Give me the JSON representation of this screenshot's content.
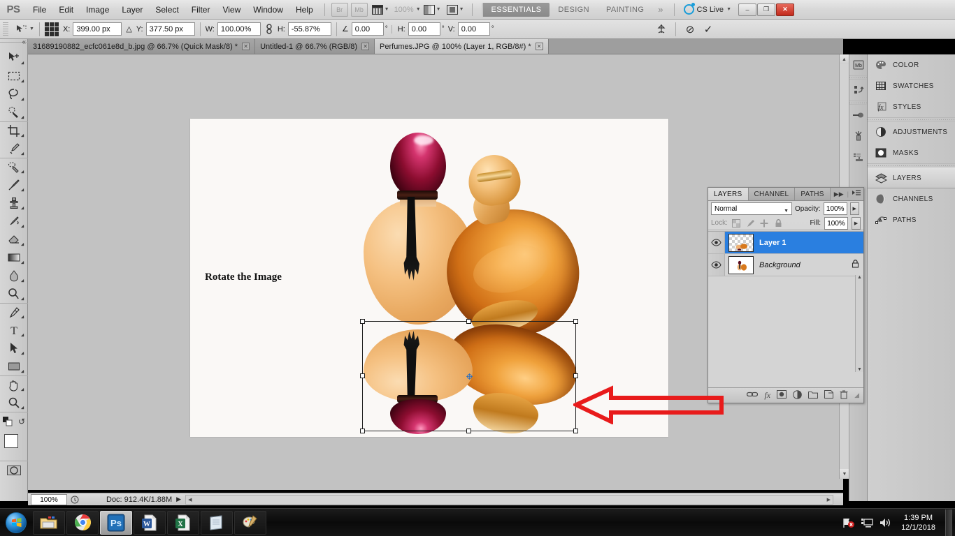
{
  "app": {
    "logo": "PS",
    "menus": [
      "File",
      "Edit",
      "Image",
      "Layer",
      "Select",
      "Filter",
      "View",
      "Window",
      "Help"
    ],
    "bridge_label": "Br",
    "minibridge_label": "Mb",
    "zoom_level": "100%",
    "workspaces": [
      "ESSENTIALS",
      "DESIGN",
      "PAINTING"
    ],
    "workspace_active": "ESSENTIALS",
    "workspace_overflow": "»",
    "cs_live": "CS Live",
    "window_minimize": "–",
    "window_restore": "❐",
    "window_close": "✕"
  },
  "options_bar": {
    "tool_icon": "move-tool-icon",
    "x_label": "X:",
    "x_value": "399.00 px",
    "delta_symbol": "△",
    "y_label": "Y:",
    "y_value": "377.50 px",
    "w_label": "W:",
    "w_value": "100.00%",
    "link_icon": "chain-link-icon",
    "h_label": "H:",
    "h_value": "-55.87%",
    "angle_icon": "∠",
    "angle_value": "0.00",
    "degree": "°",
    "skew_h_label": "H:",
    "skew_h_value": "0.00",
    "skew_v_label": "V:",
    "skew_v_value": "0.00",
    "warp_icon": "warp-mode-icon",
    "cancel_icon": "⊘",
    "commit_icon": "✓"
  },
  "doc_tabs": [
    {
      "label": "31689190882_ecfc061e8d_b.jpg @ 66.7% (Quick Mask/8) *",
      "active": false,
      "close": "✕"
    },
    {
      "label": "Untitled-1 @ 66.7% (RGB/8)",
      "active": false,
      "close": "✕"
    },
    {
      "label": "Perfumes.JPG @ 100% (Layer 1, RGB/8#) *",
      "active": true,
      "close": "✕"
    }
  ],
  "toolbox": {
    "tools": [
      {
        "name": "move-tool",
        "glyph": "✥"
      },
      {
        "name": "rectangular-marquee-tool",
        "glyph": "⬚"
      },
      {
        "name": "lasso-tool",
        "glyph": "◌"
      },
      {
        "name": "quick-selection-tool",
        "glyph": "❁"
      },
      {
        "name": "crop-tool",
        "glyph": "⌗"
      },
      {
        "name": "eyedropper-tool",
        "glyph": "✒"
      },
      {
        "name": "spot-healing-brush-tool",
        "glyph": "❂"
      },
      {
        "name": "brush-tool",
        "glyph": "✎"
      },
      {
        "name": "clone-stamp-tool",
        "glyph": "⚓"
      },
      {
        "name": "history-brush-tool",
        "glyph": "✿"
      },
      {
        "name": "eraser-tool",
        "glyph": "✂"
      },
      {
        "name": "gradient-tool",
        "glyph": "◨"
      },
      {
        "name": "blur-tool",
        "glyph": "●"
      },
      {
        "name": "dodge-tool",
        "glyph": "◖"
      },
      {
        "name": "pen-tool",
        "glyph": "✐"
      },
      {
        "name": "horizontal-type-tool",
        "glyph": "T"
      },
      {
        "name": "path-selection-tool",
        "glyph": "➤"
      },
      {
        "name": "rectangle-shape-tool",
        "glyph": "▭"
      },
      {
        "name": "hand-tool",
        "glyph": "✋"
      },
      {
        "name": "zoom-tool",
        "glyph": "⌕"
      }
    ],
    "swap_colors_icon": "↺",
    "quick_mask_icon": "◯"
  },
  "canvas": {
    "annotation_text": "Rotate the Image",
    "red_arrow": {
      "name": "red-annotation-arrow",
      "color": "#e81b1b",
      "direction": "left"
    },
    "transform_handles": 8
  },
  "status_bar": {
    "zoom": "100%",
    "doc_info": "Doc: 912.4K/1.88M",
    "arrow": "▶"
  },
  "layers_panel": {
    "tabs": [
      "LAYERS",
      "CHANNEL",
      "PATHS"
    ],
    "active_tab": "LAYERS",
    "collapse_icon": "▶▶",
    "menu_icon": "≡",
    "blend_mode": "Normal",
    "opacity_label": "Opacity:",
    "opacity_value": "100%",
    "lock_label": "Lock:",
    "lock_icons": [
      "lock-transparent-pixels-icon",
      "lock-image-pixels-icon",
      "lock-position-icon",
      "lock-all-icon"
    ],
    "fill_label": "Fill:",
    "fill_value": "100%",
    "layers": [
      {
        "name": "Layer 1",
        "selected": true,
        "visible": true,
        "locked": false,
        "italic": false
      },
      {
        "name": "Background",
        "selected": false,
        "visible": true,
        "locked": true,
        "italic": true
      }
    ],
    "footer_icons": [
      {
        "name": "link-layers-icon",
        "glyph": "⚭"
      },
      {
        "name": "layer-style-fx-icon",
        "glyph": "fx"
      },
      {
        "name": "add-layer-mask-icon",
        "glyph": "▣"
      },
      {
        "name": "new-fill-adjustment-layer-icon",
        "glyph": "◑"
      },
      {
        "name": "new-group-icon",
        "glyph": "▱"
      },
      {
        "name": "new-layer-icon",
        "glyph": "▧"
      },
      {
        "name": "delete-layer-icon",
        "glyph": "⌧"
      }
    ]
  },
  "right_dock": {
    "groups": [
      [
        {
          "label": "COLOR",
          "icon": "color-palette-icon",
          "active": false
        },
        {
          "label": "SWATCHES",
          "icon": "swatches-grid-icon",
          "active": false
        },
        {
          "label": "STYLES",
          "icon": "styles-fx-icon",
          "active": false
        }
      ],
      [
        {
          "label": "ADJUSTMENTS",
          "icon": "adjustments-halfcircle-icon",
          "active": false
        },
        {
          "label": "MASKS",
          "icon": "masks-icon",
          "active": false
        }
      ],
      [
        {
          "label": "LAYERS",
          "icon": "layers-stack-icon",
          "active": true
        },
        {
          "label": "CHANNELS",
          "icon": "channels-sphere-icon",
          "active": false
        },
        {
          "label": "PATHS",
          "icon": "paths-pen-icon",
          "active": false
        }
      ]
    ],
    "strip_icons": [
      "mini-bridge-icon",
      "history-icon",
      "brush-preset-icon",
      "brush-tool-icon",
      "tool-preset-icon"
    ]
  },
  "taskbar": {
    "start": "windows-start-orb",
    "items": [
      {
        "name": "windows-explorer",
        "active": false
      },
      {
        "name": "google-chrome",
        "active": false
      },
      {
        "name": "adobe-photoshop",
        "active": true
      },
      {
        "name": "microsoft-word",
        "active": false
      },
      {
        "name": "microsoft-excel",
        "active": false
      },
      {
        "name": "notepad",
        "active": false
      },
      {
        "name": "paint",
        "active": false
      }
    ],
    "tray": [
      "network-error-icon",
      "action-center-icon",
      "volume-icon"
    ],
    "time": "1:39 PM",
    "date": "12/1/2018"
  }
}
